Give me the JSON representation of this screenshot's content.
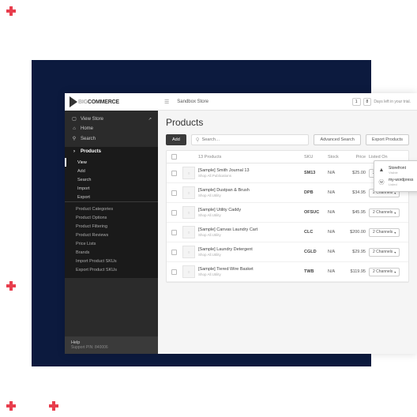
{
  "brand": {
    "prefix": "BIG",
    "suffix": "COMMERCE"
  },
  "sidebar": {
    "top": [
      {
        "icon": "⬚",
        "label": "View Store",
        "external": true
      },
      {
        "icon": "⌂",
        "label": "Home"
      },
      {
        "icon": "⚲",
        "label": "Search"
      }
    ],
    "products_label": "Products",
    "sub": [
      "View",
      "Add",
      "Search",
      "Import",
      "Export"
    ],
    "group": [
      "Product Categories",
      "Product Options",
      "Product Filtering",
      "Product Reviews",
      "Price Lists",
      "Brands",
      "Import Product SKUs",
      "Export Product SKUs"
    ],
    "help_title": "Help",
    "help_sub": "Support PIN: 840006"
  },
  "header": {
    "store": "Sandbox Store",
    "trial_days": "1",
    "trial_unit": "8",
    "trial_text": "Days left in your trial."
  },
  "page": {
    "title": "Products",
    "add": "Add",
    "search_placeholder": "Search…",
    "advanced": "Advanced Search",
    "export": "Export Products"
  },
  "table": {
    "count_label": "13 Products",
    "cols": {
      "sku": "SKU",
      "stock": "Stock",
      "price": "Price",
      "listed": "Listed On"
    },
    "rows": [
      {
        "name": "[Sample] Smith Journal 13",
        "sub": "Shop All.Publications",
        "sku": "SM13",
        "stock": "N/A",
        "price": "$25.00",
        "listed": "2 Channels"
      },
      {
        "name": "[Sample] Dustpan & Brush",
        "sub": "Shop All.Utility",
        "sku": "DPB",
        "stock": "N/A",
        "price": "$34.95",
        "listed": "2 Channels"
      },
      {
        "name": "[Sample] Utility Caddy",
        "sub": "Shop All.Utility",
        "sku": "OFSUC",
        "stock": "N/A",
        "price": "$45.95",
        "listed": "2 Channels"
      },
      {
        "name": "[Sample] Canvas Laundry Cart",
        "sub": "Shop All.Utility",
        "sku": "CLC",
        "stock": "N/A",
        "price": "$200.00",
        "listed": "2 Channels"
      },
      {
        "name": "[Sample] Laundry Detergent",
        "sub": "Shop All.Utility",
        "sku": "CGLD",
        "stock": "N/A",
        "price": "$29.95",
        "listed": "2 Channels"
      },
      {
        "name": "[Sample] Tiered Wire Basket",
        "sub": "Shop All.Utility",
        "sku": "TWB",
        "stock": "N/A",
        "price": "$119.95",
        "listed": "2 Channels"
      }
    ]
  },
  "dropdown": {
    "items": [
      {
        "name": "Storefront",
        "sub": "Visible"
      },
      {
        "name": "my-wordpress",
        "sub": "Listed"
      }
    ]
  }
}
